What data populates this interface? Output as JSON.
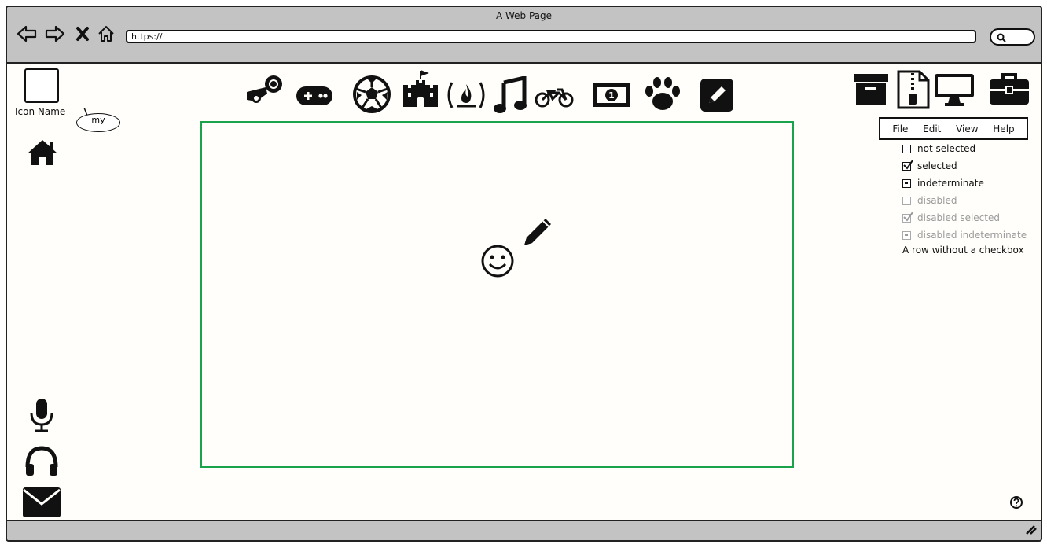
{
  "window": {
    "title": "A Web Page"
  },
  "browser": {
    "url": "https://",
    "nav_icons": [
      "back-arrow-icon",
      "forward-arrow-icon",
      "close-x-icon",
      "home-outline-icon"
    ],
    "search_icon": "search-icon"
  },
  "left_panel": {
    "icon_label": "Icon Name",
    "bubble_text": "my",
    "icons": [
      "home-icon",
      "microphone-icon",
      "headphones-icon",
      "envelope-icon"
    ]
  },
  "toolbar_icons": [
    "steam-icon",
    "gamepad-icon",
    "soccer-ball-icon",
    "castle-icon",
    "fire-icon",
    "music-note-icon",
    "motorcycle-icon",
    "money-icon",
    "paw-icon",
    "edit-square-icon"
  ],
  "right_icons": [
    "archive-box-icon",
    "zip-file-icon",
    "monitor-icon",
    "briefcase-icon"
  ],
  "menu": {
    "items": [
      "File",
      "Edit",
      "View",
      "Help"
    ]
  },
  "checkbox_list": {
    "items": [
      {
        "label": "not selected",
        "state": "unchecked",
        "disabled": false
      },
      {
        "label": "selected",
        "state": "checked",
        "disabled": false
      },
      {
        "label": "indeterminate",
        "state": "indeterminate",
        "disabled": false
      },
      {
        "label": "disabled",
        "state": "unchecked",
        "disabled": true
      },
      {
        "label": "disabled selected",
        "state": "checked",
        "disabled": true
      },
      {
        "label": "disabled indeterminate",
        "state": "indeterminate",
        "disabled": true
      }
    ],
    "plain_row": "A row without a checkbox"
  },
  "canvas": {
    "border_color": "#19a34a",
    "icons": [
      "smiley-icon",
      "pencil-icon"
    ]
  },
  "help_icon": "help-icon",
  "resize_icon": "resize-grip-icon"
}
